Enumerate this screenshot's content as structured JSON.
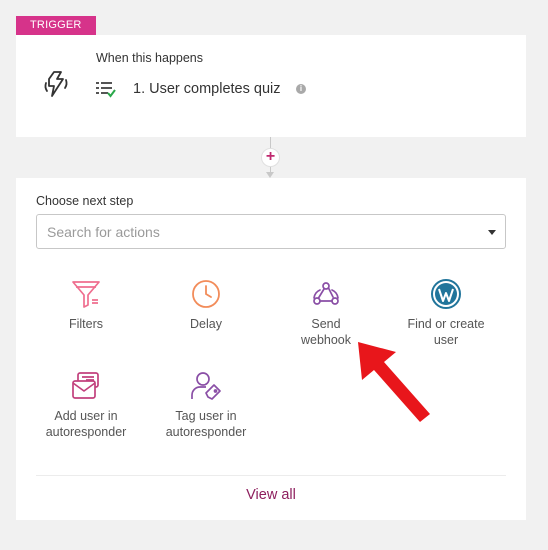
{
  "trigger": {
    "badge": "TRIGGER",
    "when_label": "When this happens",
    "step_title": "1. User completes quiz",
    "info_glyph": "i",
    "icon": "lightning-bolt-icon"
  },
  "connector": {
    "add_glyph": "+"
  },
  "actions": {
    "choose_label": "Choose next step",
    "search_placeholder": "Search for actions",
    "items": [
      {
        "label_line1": "Filters",
        "label_line2": "",
        "icon": "filter-funnel-icon",
        "color": "#ef6e8f"
      },
      {
        "label_line1": "Delay",
        "label_line2": "",
        "icon": "clock-icon",
        "color": "#f28c5a"
      },
      {
        "label_line1": "Send",
        "label_line2": "webhook",
        "icon": "webhook-icon",
        "color": "#8a4fa6"
      },
      {
        "label_line1": "Find or create",
        "label_line2": "user",
        "icon": "wordpress-icon",
        "color": "#21759b"
      },
      {
        "label_line1": "Add user in",
        "label_line2": "autoresponder",
        "icon": "mail-add-icon",
        "color": "#c2417d"
      },
      {
        "label_line1": "Tag user in",
        "label_line2": "autoresponder",
        "icon": "user-tag-icon",
        "color": "#8a4fa6"
      }
    ],
    "view_all": "View all"
  },
  "colors": {
    "brand_pink": "#d6338a",
    "link_purple": "#8e1f5e",
    "annotation_red": "#e8161b"
  }
}
